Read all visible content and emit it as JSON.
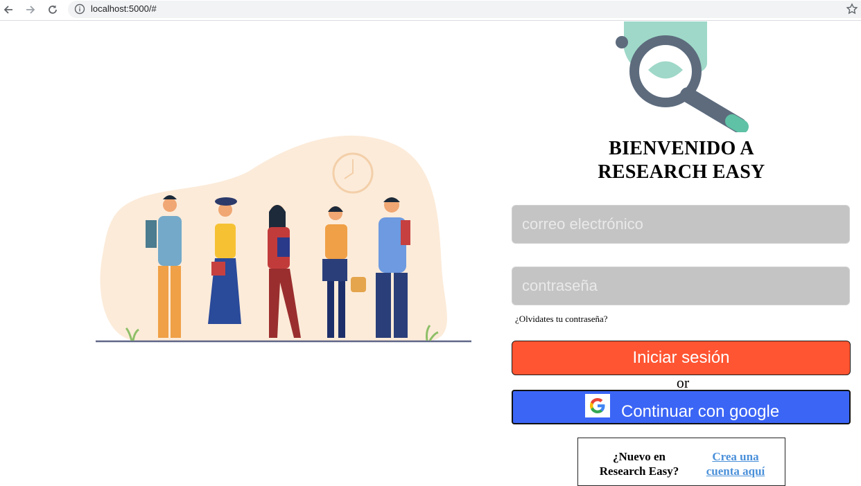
{
  "browser": {
    "url": "localhost:5000/#",
    "icons": [
      "back-arrow-icon",
      "forward-arrow-icon",
      "reload-icon",
      "info-icon",
      "star-icon"
    ]
  },
  "title_line1": "BIENVENIDO A",
  "title_line2": "RESEARCH EASY",
  "form": {
    "email_placeholder": "correo electrónico",
    "password_placeholder": "contraseña",
    "forgot_label": "¿Olvidates tu contraseña?",
    "login_label": "Iniciar sesión",
    "or_label": "or",
    "google_label": "Continuar con google"
  },
  "register": {
    "question": "¿Nuevo en Research Easy?",
    "link_label": "Crea una cuenta aquí"
  },
  "colors": {
    "login_button": "#ff5532",
    "google_button": "#3b65f5",
    "input_bg": "#c4c4c4",
    "link": "#4a90d9"
  }
}
